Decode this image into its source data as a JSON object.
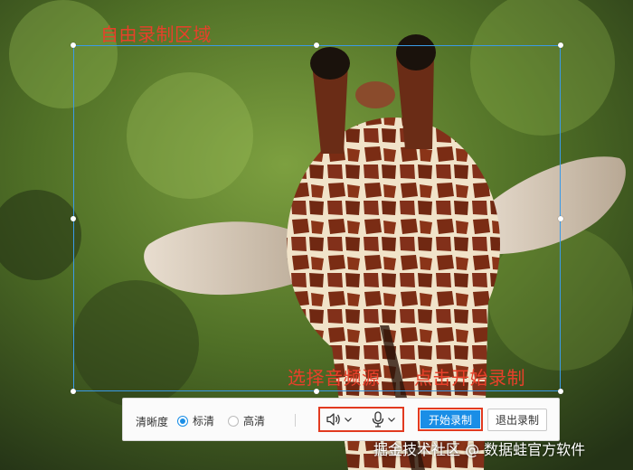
{
  "annotations": {
    "region_label": "自由录制区域",
    "audio_label": "选择音频源",
    "start_label": "点击开始录制"
  },
  "toolbar": {
    "quality_label": "清晰度",
    "quality_options": [
      {
        "label": "标清",
        "selected": true
      },
      {
        "label": "高清",
        "selected": false
      }
    ],
    "speaker_icon": "speaker-icon",
    "mic_icon": "microphone-icon",
    "start_button": "开始录制",
    "exit_button": "退出录制"
  },
  "colors": {
    "accent_blue": "#1a8ee6",
    "annotation_red": "#e8402a",
    "selection_border": "#3a9be8"
  },
  "watermark": "掘金技术社区 @ 数据蛙官方软件"
}
